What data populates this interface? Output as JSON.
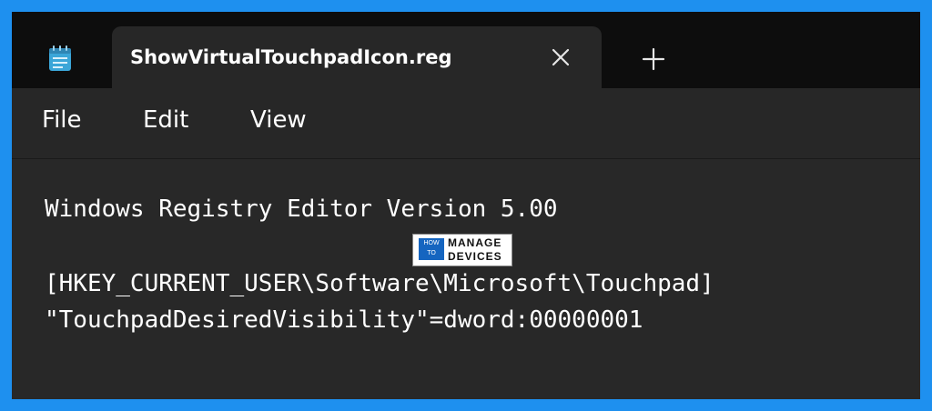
{
  "colors": {
    "frame": "#1e90ef",
    "titlebar": "#0d0d0d",
    "tab": "#272727",
    "editor": "#282828",
    "text": "#ffffff",
    "icon_accent": "#3ba6d8"
  },
  "icons": {
    "app": "notepad-icon",
    "close": "close-icon",
    "new_tab": "plus-icon"
  },
  "tab": {
    "title": "ShowVirtualTouchpadIcon.reg"
  },
  "menu": {
    "items": [
      "File",
      "Edit",
      "View"
    ]
  },
  "editor": {
    "lines": [
      "Windows Registry Editor Version 5.00",
      "[HKEY_CURRENT_USER\\Software\\Microsoft\\Touchpad]",
      "\"TouchpadDesiredVisibility\"=dword:00000001"
    ]
  },
  "watermark": {
    "line1": "HOW",
    "line2": "TO",
    "word1": "MANAGE",
    "word2": "DEVICES"
  }
}
